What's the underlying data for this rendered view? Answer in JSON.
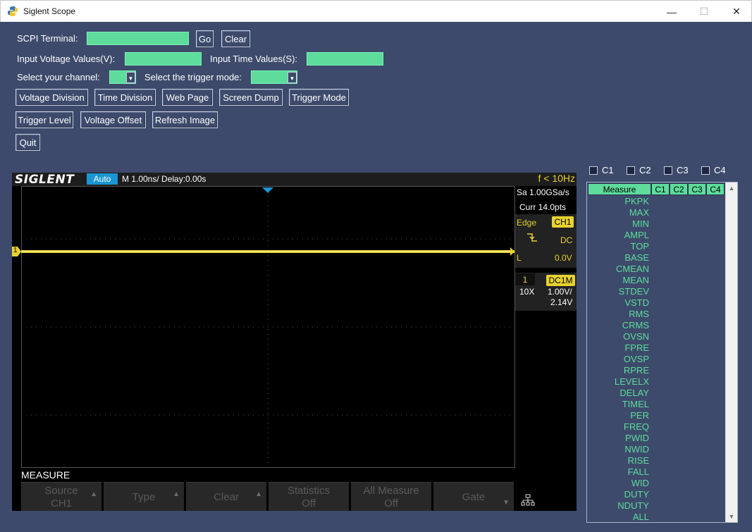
{
  "window": {
    "title": "Siglent Scope",
    "minimize": "—",
    "maximize": "☐",
    "close": "✕"
  },
  "controls": {
    "scpi_label": "SCPI Terminal:",
    "go_label": "Go",
    "clear_label": "Clear",
    "voltage_label": "Input Voltage Values(V):",
    "time_label": "Input Time Values(S):",
    "channel_label": "Select your channel:",
    "trigger_mode_label": "Select the trigger mode:",
    "buttons_row1": [
      "Voltage Division",
      "Time Division",
      "Web Page",
      "Screen Dump",
      "Trigger Mode"
    ],
    "buttons_row2": [
      "Trigger Level",
      "Voltage Offset",
      "Refresh Image"
    ],
    "quit_label": "Quit"
  },
  "scope": {
    "brand": "SIGLENT",
    "mode": "Auto",
    "timebase": "M 1.00ns/  Delay:0.00s",
    "frequency": "f < 10Hz",
    "sample_rate": "Sa 1.00GSa/s",
    "curr_pts": "Curr 14.0pts",
    "trigger_type": "Edge",
    "trigger_source": "CH1",
    "coupling": "DC",
    "level_label": "L",
    "level_value": "0.0V",
    "channel_num": "1",
    "channel_badge": "DC1M",
    "probe": "10X",
    "volts_div": "1.00V/",
    "offset": "2.14V",
    "ch_marker": "1",
    "measure_title": "MEASURE",
    "softkeys": [
      {
        "line1": "Source",
        "line2": "CH1",
        "arrow": "up"
      },
      {
        "line1": "Type",
        "line2": "",
        "arrow": "up"
      },
      {
        "line1": "Clear",
        "line2": "",
        "arrow": "up"
      },
      {
        "line1": "Statistics",
        "line2": "Off",
        "arrow": ""
      },
      {
        "line1": "All Measure",
        "line2": "Off",
        "arrow": ""
      },
      {
        "line1": "Gate",
        "line2": "",
        "arrow": "down"
      }
    ],
    "trace_color": "#e8d230"
  },
  "channels": [
    "C1",
    "C2",
    "C3",
    "C4"
  ],
  "measure": {
    "header": [
      "Measure",
      "C1",
      "C2",
      "C3",
      "C4"
    ],
    "items": [
      "PKPK",
      "MAX",
      "MIN",
      "AMPL",
      "TOP",
      "BASE",
      "CMEAN",
      "MEAN",
      "STDEV",
      "VSTD",
      "RMS",
      "CRMS",
      "OVSN",
      "FPRE",
      "OVSP",
      "RPRE",
      "LEVELX",
      "DELAY",
      "TIMEL",
      "PER",
      "FREQ",
      "PWID",
      "NWID",
      "RISE",
      "FALL",
      "WID",
      "DUTY",
      "NDUTY",
      "ALL"
    ]
  },
  "colors": {
    "background": "#3d4a6b",
    "accent": "#5ddc9c",
    "trace": "#e8d230",
    "scope_blue": "#1b96d2"
  }
}
